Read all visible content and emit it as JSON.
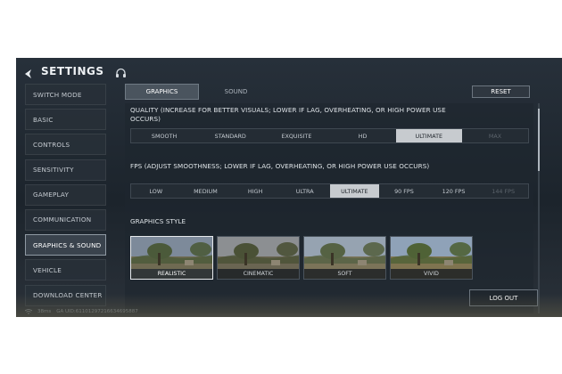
{
  "header": {
    "title": "SETTINGS"
  },
  "sidebar": {
    "items": [
      {
        "label": "SWITCH MODE"
      },
      {
        "label": "BASIC"
      },
      {
        "label": "CONTROLS"
      },
      {
        "label": "SENSITIVITY"
      },
      {
        "label": "GAMEPLAY"
      },
      {
        "label": "COMMUNICATION"
      },
      {
        "label": "GRAPHICS & SOUND",
        "active": true
      },
      {
        "label": "VEHICLE"
      },
      {
        "label": "DOWNLOAD CENTER"
      }
    ]
  },
  "tabs": [
    {
      "label": "GRAPHICS",
      "active": true
    },
    {
      "label": "SOUND"
    }
  ],
  "reset_label": "RESET",
  "quality": {
    "label": "QUALITY (INCREASE FOR BETTER VISUALS; LOWER IF LAG, OVERHEATING, OR HIGH POWER USE OCCURS)",
    "options": [
      "SMOOTH",
      "STANDARD",
      "EXQUISITE",
      "HD",
      "ULTIMATE",
      "MAX"
    ],
    "selected": "ULTIMATE",
    "disabled": [
      "MAX"
    ]
  },
  "fps": {
    "label": "FPS (ADJUST SMOOTHNESS; LOWER IF LAG, OVERHEATING, OR HIGH POWER USE OCCURS)",
    "options": [
      "LOW",
      "MEDIUM",
      "HIGH",
      "ULTRA",
      "ULTIMATE",
      "90 FPS",
      "120 FPS",
      "144 FPS"
    ],
    "selected": "ULTIMATE",
    "disabled": [
      "144 FPS"
    ]
  },
  "graphics_style": {
    "label": "GRAPHICS STYLE",
    "options": [
      "REALISTIC",
      "CINEMATIC",
      "SOFT",
      "VIVID"
    ],
    "selected": "REALISTIC"
  },
  "logout_label": "LOG OUT",
  "status": {
    "ping": "38ms",
    "uid": "GA UID:61101297216634695887"
  },
  "colors": {
    "accent": "#c7cbcf",
    "panel": "#1c242c"
  }
}
